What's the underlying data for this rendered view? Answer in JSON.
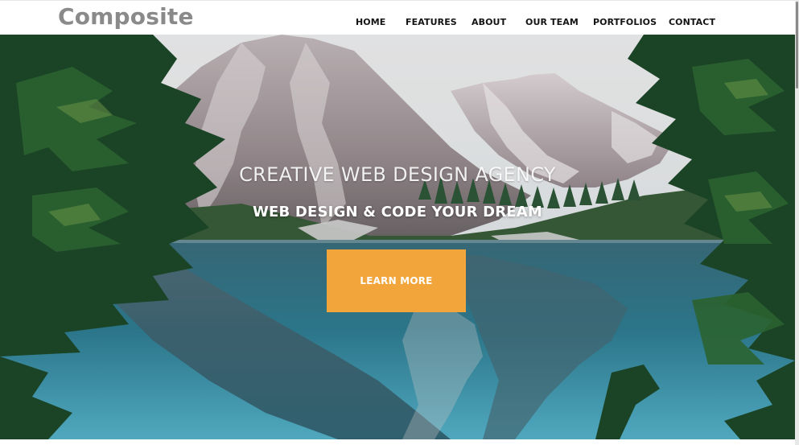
{
  "brand": {
    "name": "Composite"
  },
  "nav": {
    "items": [
      {
        "label": "HOME"
      },
      {
        "label": "FEATURES"
      },
      {
        "label": "ABOUT"
      },
      {
        "label": "OUR TEAM"
      },
      {
        "label": "PORTFOLIOS"
      },
      {
        "label": "CONTACT"
      }
    ]
  },
  "hero": {
    "title": "CREATIVE WEB DESIGN AGENCY",
    "subtitle": "WEB DESIGN & CODE YOUR DREAM",
    "cta_label": "LEARN MORE",
    "image": "mountain-lake-landscape"
  },
  "colors": {
    "accent": "#f2a53a",
    "brand_text": "#8a8a8a",
    "nav_text": "#141414",
    "nav_bg": "#ffffff"
  }
}
